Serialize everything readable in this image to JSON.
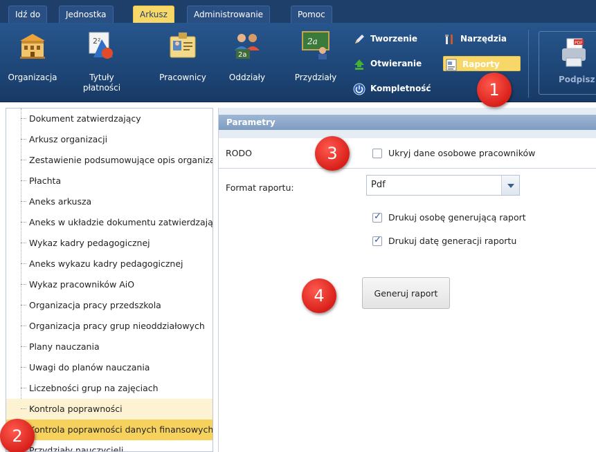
{
  "menu": {
    "tabs": [
      {
        "label": "Idź do"
      },
      {
        "label": "Jednostka"
      },
      {
        "label": "Arkusz"
      },
      {
        "label": "Administrowanie"
      },
      {
        "label": "Pomoc"
      }
    ],
    "active_tab": "Arkusz"
  },
  "ribbon": {
    "big_buttons": [
      {
        "label": "Organizacja",
        "icon": "building-icon"
      },
      {
        "label": "Tytuły",
        "label2": "płatności",
        "icon": "math-shapes-icon"
      },
      {
        "label": "Pracownicy",
        "icon": "staff-card-icon"
      },
      {
        "label": "Oddziały",
        "icon": "students-group-icon"
      },
      {
        "label": "Przydziały",
        "icon": "board-teacher-icon"
      }
    ],
    "small_buttons": [
      {
        "label": "Tworzenie",
        "icon": "pencil-icon"
      },
      {
        "label": "Otwieranie",
        "icon": "upload-arrow-icon"
      },
      {
        "label": "Kompletność",
        "icon": "power-icon"
      },
      {
        "label": "Narzędzia",
        "icon": "tools-icon"
      },
      {
        "label": "Raporty",
        "icon": "report-icon"
      }
    ],
    "active_small": "Raporty",
    "podpisz_label": "Podpisz"
  },
  "report_list": {
    "items": [
      "Dokument zatwierdzający",
      "Arkusz organizacji",
      "Zestawienie podsumowujące opis organizacji",
      "Płachta",
      "Aneks arkusza",
      "Aneks w układzie dokumentu zatwierdzającego",
      "Wykaz kadry pedagogicznej",
      "Aneks wykazu kadry pedagogicznej",
      "Wykaz pracowników AiO",
      "Organizacja pracy przedszkola",
      "Organizacja pracy grup nieoddziałowych",
      "Plany nauczania",
      "Uwagi do planów nauczania",
      "Liczebności grup na zajęciach",
      "Kontrola poprawności",
      "Kontrola poprawności danych finansowych",
      "Przydziały nauczycieli"
    ],
    "hover_item": "Kontrola poprawności",
    "selected_item": "Kontrola poprawności danych finansowych"
  },
  "params": {
    "title": "Parametry",
    "rodo_label": "RODO",
    "hide_personal_label": "Ukryj dane osobowe pracowników",
    "hide_personal_checked": false,
    "format_label": "Format raportu:",
    "format_value": "Pdf",
    "print_person_label": "Drukuj osobę generującą raport",
    "print_person_checked": true,
    "print_date_label": "Drukuj datę generacji raportu",
    "print_date_checked": true,
    "generate_label": "Generuj raport"
  },
  "badges": [
    "1",
    "2",
    "3",
    "4"
  ],
  "colors": {
    "menubar": "#1f3f6b",
    "ribbon": "#1c4373",
    "active_tab": "#f7d768",
    "selected_row": "#f6d25d",
    "hover_row": "#fdf3d2",
    "params_header": "#7e9cc1",
    "badge": "#d8201a"
  }
}
